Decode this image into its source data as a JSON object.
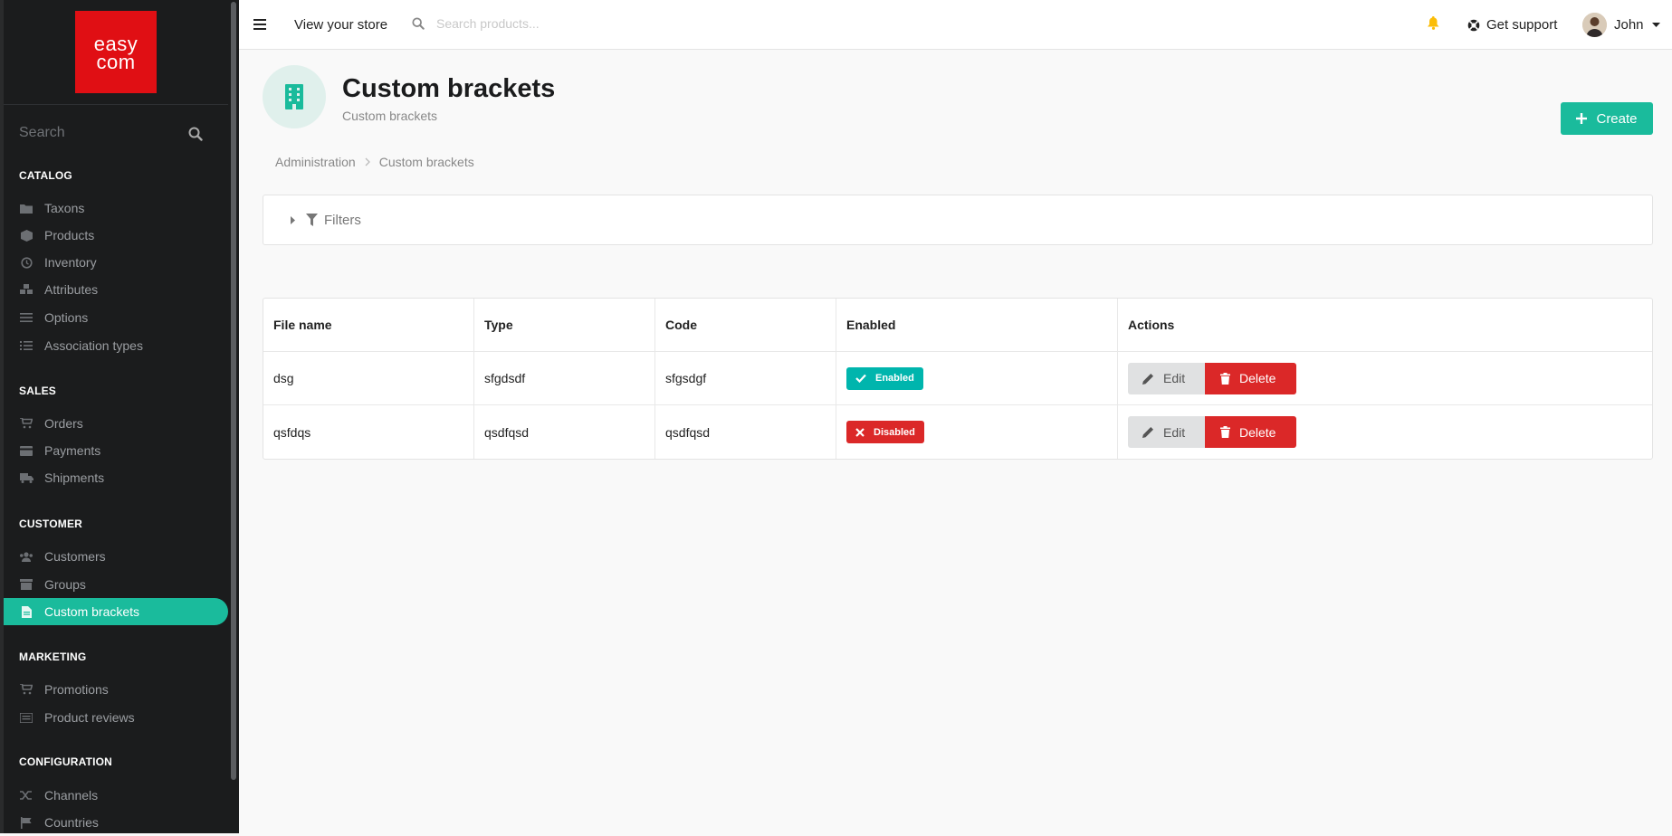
{
  "sidebar": {
    "logo_line1": "easy",
    "logo_line2": "com",
    "search_placeholder": "Search",
    "sections": {
      "catalog": "CATALOG",
      "sales": "SALES",
      "customer": "CUSTOMER",
      "marketing": "MARKETING",
      "configuration": "CONFIGURATION"
    },
    "items": {
      "taxons": "Taxons",
      "products": "Products",
      "inventory": "Inventory",
      "attributes": "Attributes",
      "options": "Options",
      "association_types": "Association types",
      "orders": "Orders",
      "payments": "Payments",
      "shipments": "Shipments",
      "customers": "Customers",
      "groups": "Groups",
      "custom_brackets": "Custom brackets",
      "promotions": "Promotions",
      "product_reviews": "Product reviews",
      "channels": "Channels",
      "countries": "Countries"
    }
  },
  "topbar": {
    "view_store": "View your store",
    "search_placeholder": "Search products...",
    "support": "Get support",
    "user": "John"
  },
  "header": {
    "title": "Custom brackets",
    "subtitle": "Custom brackets",
    "create_label": "Create"
  },
  "breadcrumb": {
    "root": "Administration",
    "current": "Custom brackets"
  },
  "filters": {
    "label": "Filters"
  },
  "table": {
    "columns": [
      "File name",
      "Type",
      "Code",
      "Enabled",
      "Actions"
    ],
    "rows": [
      {
        "file_name": "dsg",
        "type": "sfgdsdf",
        "code": "sfgsdgf",
        "enabled": "Enabled",
        "edit": "Edit",
        "delete": "Delete"
      },
      {
        "file_name": "qsfdqs",
        "type": "qsdfqsd",
        "code": "qsdfqsd",
        "enabled": "Disabled",
        "edit": "Edit",
        "delete": "Delete"
      }
    ]
  },
  "colors": {
    "accent": "#1abb9c",
    "danger": "#db2828",
    "brand": "#e00f14",
    "enabled": "#00b5ad"
  }
}
